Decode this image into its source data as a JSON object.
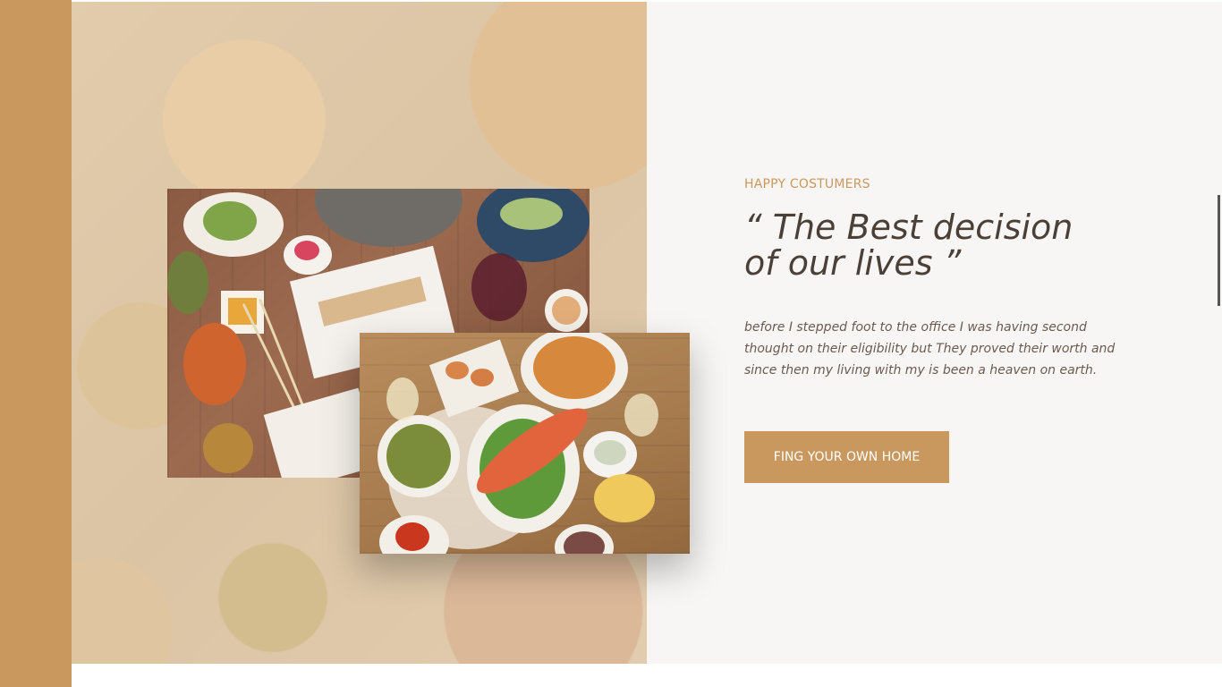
{
  "testimonial": {
    "eyebrow": "HAPPY COSTUMERS",
    "title": "“ The Best decision of our lives ”",
    "quote": "before I stepped foot to the office I was having second thought on their eligibility but They proved their worth and since then my living with my is been a heaven on earth.",
    "cta_label": "FING YOUR OWN HOME"
  },
  "colors": {
    "accent": "#c9985f",
    "heading": "#4a4038",
    "body_text": "#6a5a50",
    "panel_background": "#f8f6f4"
  }
}
